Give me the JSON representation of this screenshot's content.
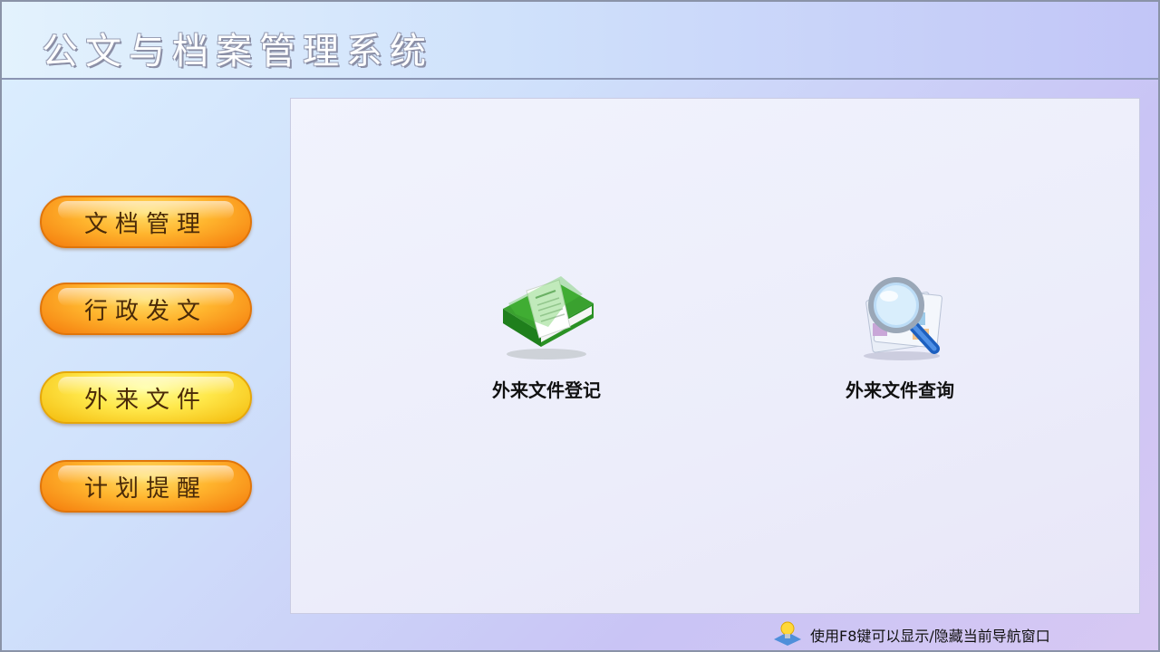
{
  "header": {
    "title": "公文与档案管理系统"
  },
  "nav": {
    "items": [
      {
        "label": "文档管理",
        "style": "orange"
      },
      {
        "label": "行政发文",
        "style": "orange"
      },
      {
        "label": "外来文件",
        "style": "yellow"
      },
      {
        "label": "计划提醒",
        "style": "orange"
      }
    ]
  },
  "main": {
    "features": [
      {
        "label": "外来文件登记",
        "icon": "green-book-icon"
      },
      {
        "label": "外来文件查询",
        "icon": "magnifier-icon"
      }
    ]
  },
  "footer": {
    "hint": "使用F8键可以显示/隐藏当前导航窗口",
    "icon": "lightbulb-icon"
  },
  "colors": {
    "accent_orange": "#f47a0b",
    "active_yellow": "#ffe84a"
  }
}
